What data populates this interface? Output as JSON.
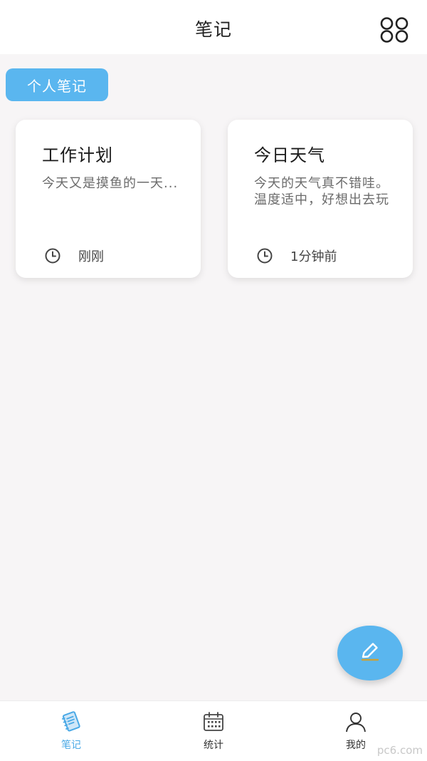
{
  "header": {
    "title": "笔记",
    "menu_icon": "grid-icon"
  },
  "category_chip": "个人笔记",
  "notes": [
    {
      "title": "工作计划",
      "body": "今天又是摸鱼的一天...",
      "time": "刚刚",
      "time_icon": "clock-icon"
    },
    {
      "title": "今日天气",
      "body": "今天的天气真不错哇。温度适中，好想出去玩",
      "time": "1分钟前",
      "time_icon": "clock-icon"
    }
  ],
  "fab": {
    "icon": "edit-icon"
  },
  "bottom_nav": [
    {
      "label": "笔记",
      "icon": "notebook-icon",
      "active": true
    },
    {
      "label": "统计",
      "icon": "calendar-icon",
      "active": false
    },
    {
      "label": "我的",
      "icon": "user-icon",
      "active": false
    }
  ],
  "watermark": "pc6.com",
  "colors": {
    "accent": "#5ab6ef",
    "background": "#f7f5f6",
    "card": "#ffffff"
  }
}
